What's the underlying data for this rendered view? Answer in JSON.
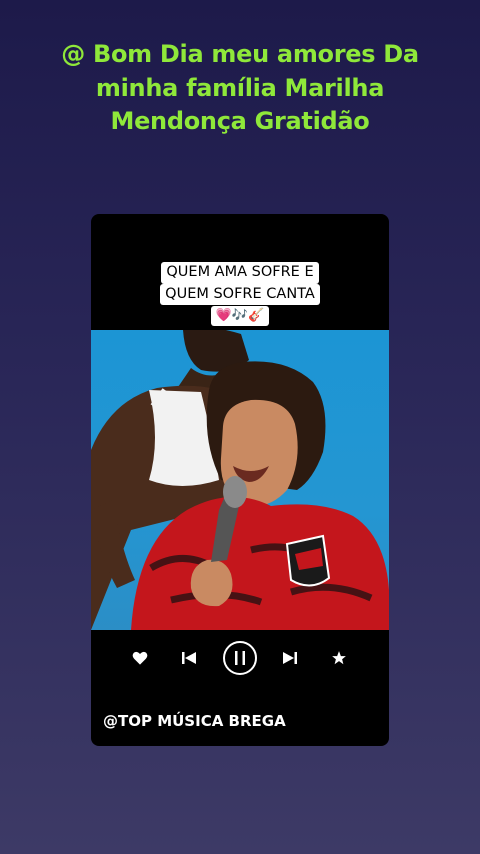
{
  "post": {
    "title": "@ Bom Dia meu amores Da minha família Marilha Mendonça Gratidão"
  },
  "video": {
    "caption_line1": "QUEM AMA SOFRE E",
    "caption_line2": "QUEM SOFRE CANTA",
    "caption_emojis": "💗🎶🎸",
    "handle": "@TOP MÚSICA BREGA"
  },
  "player": {
    "state": "playing",
    "icons": [
      "heart-icon",
      "skip-previous-icon",
      "pause-icon",
      "skip-next-icon",
      "star-icon"
    ]
  },
  "colors": {
    "title": "#8fe83a",
    "background_top": "#1d1a4a",
    "background_bottom": "#3d3a66",
    "photo_bg": "#1c95d4",
    "shirt": "#c4161c"
  }
}
